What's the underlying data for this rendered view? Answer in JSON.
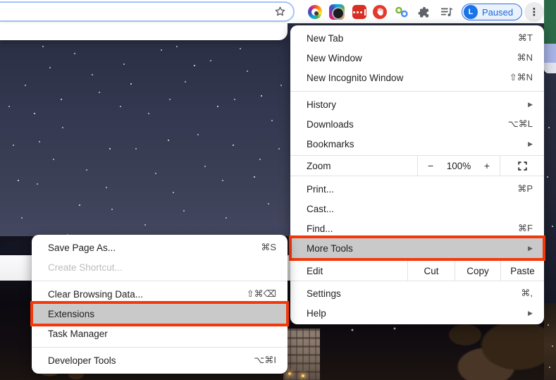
{
  "toolbar": {
    "omnibox": {
      "value": "",
      "placeholder": ""
    },
    "bookmark_icon": "star",
    "extension_icons": [
      "color-picker-extension-icon",
      "screenshot-camera-extension-icon",
      "password-dots-extension-icon",
      "stop-hand-extension-icon",
      "linked-circles-extension-icon",
      "puzzle-extensions-icon",
      "media-list-icon"
    ],
    "profile": {
      "initial": "L",
      "status_label": "Paused"
    },
    "menu_button_icon": "kebab-menu"
  },
  "icons": {
    "submenu_arrow": "▶",
    "kebab": "⋮"
  },
  "main_menu": {
    "group_new": [
      {
        "label": "New Tab",
        "shortcut": "⌘T"
      },
      {
        "label": "New Window",
        "shortcut": "⌘N"
      },
      {
        "label": "New Incognito Window",
        "shortcut": "⇧⌘N"
      }
    ],
    "group_history": [
      {
        "label": "History",
        "shortcut": "",
        "has_submenu": true
      },
      {
        "label": "Downloads",
        "shortcut": "⌥⌘L",
        "has_submenu": false
      },
      {
        "label": "Bookmarks",
        "shortcut": "",
        "has_submenu": true
      }
    ],
    "zoom_row": {
      "label": "Zoom",
      "decrease": "−",
      "value": "100%",
      "increase": "+",
      "fullscreen_icon": "fullscreen"
    },
    "group_actions": [
      {
        "label": "Print...",
        "shortcut": "⌘P",
        "has_submenu": false
      },
      {
        "label": "Cast...",
        "shortcut": "",
        "has_submenu": false
      },
      {
        "label": "Find...",
        "shortcut": "⌘F",
        "has_submenu": false
      },
      {
        "label": "More Tools",
        "shortcut": "",
        "has_submenu": true,
        "highlighted": true
      }
    ],
    "edit_row": {
      "label": "Edit",
      "cut": "Cut",
      "copy": "Copy",
      "paste": "Paste"
    },
    "group_settings": [
      {
        "label": "Settings",
        "shortcut": "⌘,",
        "has_submenu": false
      },
      {
        "label": "Help",
        "shortcut": "",
        "has_submenu": true
      }
    ]
  },
  "more_tools_submenu": {
    "group_page": [
      {
        "label": "Save Page As...",
        "shortcut": "⌘S",
        "disabled": false
      },
      {
        "label": "Create Shortcut...",
        "shortcut": "",
        "disabled": true
      }
    ],
    "group_tools": [
      {
        "label": "Clear Browsing Data...",
        "shortcut": "⇧⌘⌫",
        "highlighted": false
      },
      {
        "label": "Extensions",
        "shortcut": "",
        "highlighted": true
      },
      {
        "label": "Task Manager",
        "shortcut": "",
        "highlighted": false
      }
    ],
    "group_dev": [
      {
        "label": "Developer Tools",
        "shortcut": "⌥⌘I"
      }
    ]
  },
  "colors": {
    "annotation_highlight_border": "#f4380b",
    "menu_highlight_bg": "#c9c9c9",
    "paused_accent": "#1a73e8",
    "omnibox_focus_border": "#a6c3f7",
    "desktop_green": "#2b6a48"
  }
}
